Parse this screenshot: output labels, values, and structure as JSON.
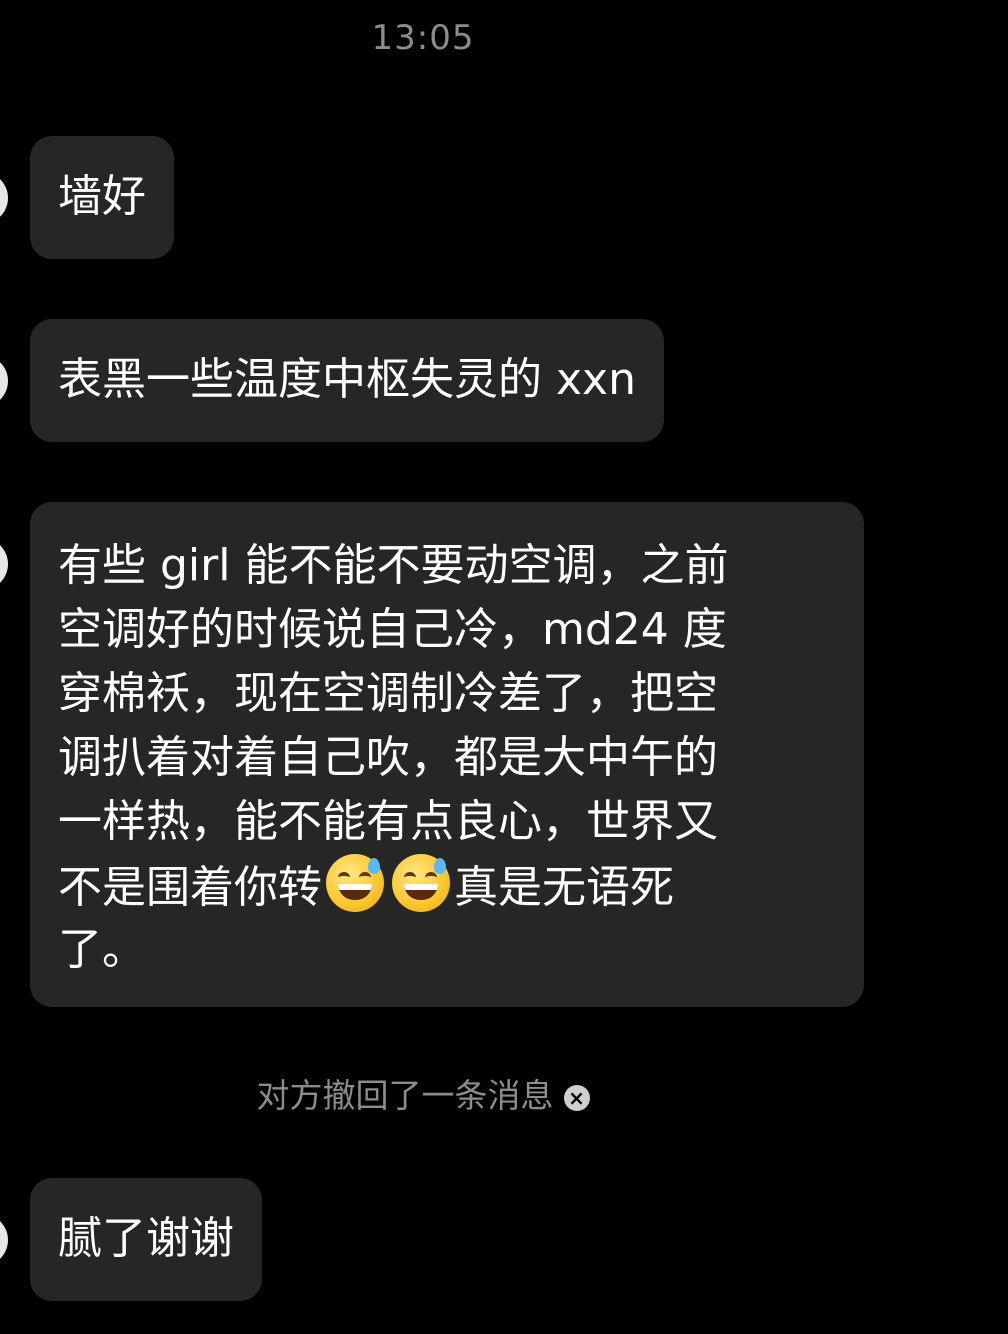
{
  "header": {
    "time": "13:05"
  },
  "messages": [
    {
      "text": "墙好"
    },
    {
      "text": "表黑一些温度中枢失灵的 xxn"
    },
    {
      "lines": [
        "有些 girl 能不能不要动空调，之前",
        "空调好的时候说自己冷，md24 度",
        "穿棉袄，现在空调制冷差了，把空",
        "调扒着对着自己吹，都是大中午的",
        "一样热，能不能有点良心，世界又"
      ],
      "line6_before_emoji": "不是围着你转",
      "line6_after_emoji": "真是无语死",
      "line7": "了。",
      "emoji_icon": "grinning-face-with-sweat"
    },
    {
      "text": "腻了谢谢"
    }
  ],
  "system_note": {
    "text": "对方撤回了一条消息",
    "icon": "close-icon"
  },
  "colors": {
    "background": "#000000",
    "bubble": "#262626",
    "muted_text": "#8c8c8c"
  }
}
